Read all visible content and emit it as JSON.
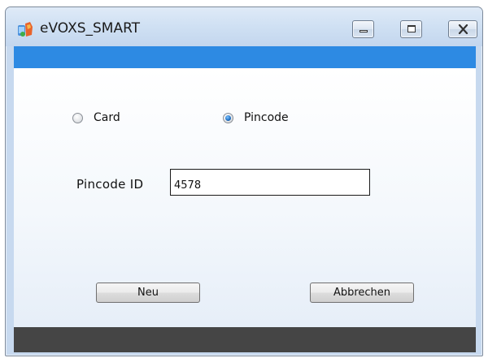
{
  "window": {
    "title": "eVOXS_SMART",
    "icon": "app-icon",
    "controls": {
      "minimize_icon": "minimize-icon",
      "maximize_icon": "maximize-icon",
      "close_icon": "close-icon"
    }
  },
  "colors": {
    "header_band": "#2d8ae3",
    "footer_band": "#454545"
  },
  "auth_mode": {
    "options": [
      {
        "label": "Card",
        "checked": false
      },
      {
        "label": "Pincode",
        "checked": true
      }
    ]
  },
  "pincode": {
    "label": "Pincode ID",
    "value": "4578"
  },
  "buttons": {
    "new_label": "Neu",
    "cancel_label": "Abbrechen"
  }
}
